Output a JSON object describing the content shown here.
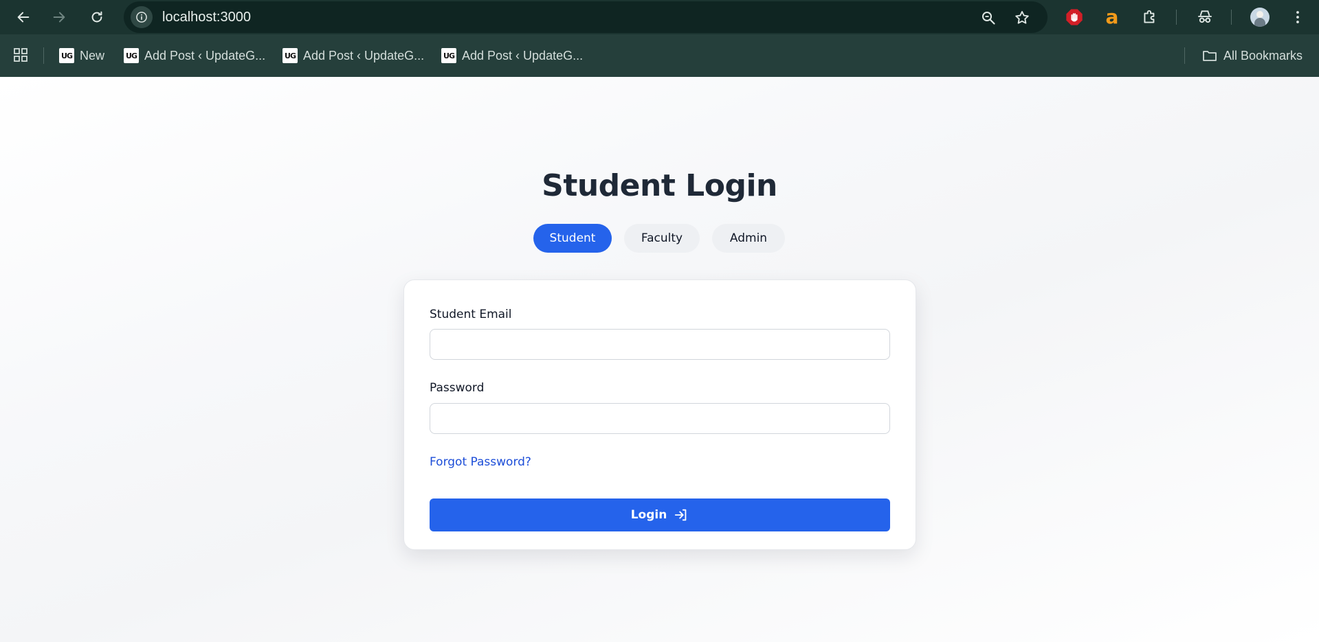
{
  "browser": {
    "url": "localhost:3000",
    "bookmarks": [
      {
        "label": "New",
        "icon": "ug-logo"
      },
      {
        "label": "Add Post ‹ UpdateG...",
        "icon": "ug-logo"
      },
      {
        "label": "Add Post ‹ UpdateG...",
        "icon": "ug-logo"
      },
      {
        "label": "Add Post ‹ UpdateG...",
        "icon": "ug-logo"
      }
    ],
    "bookmark_logo_text": "UG",
    "all_bookmarks_label": "All Bookmarks",
    "extension_logo_letter": "a"
  },
  "login": {
    "title": "Student Login",
    "roles": [
      {
        "label": "Student",
        "active": true
      },
      {
        "label": "Faculty",
        "active": false
      },
      {
        "label": "Admin",
        "active": false
      }
    ],
    "email_label": "Student Email",
    "email_value": "",
    "password_label": "Password",
    "password_value": "",
    "forgot_label": "Forgot Password?",
    "submit_label": "Login"
  },
  "colors": {
    "accent": "#2563eb",
    "chrome": "#1b3430",
    "title": "#1f2937"
  }
}
